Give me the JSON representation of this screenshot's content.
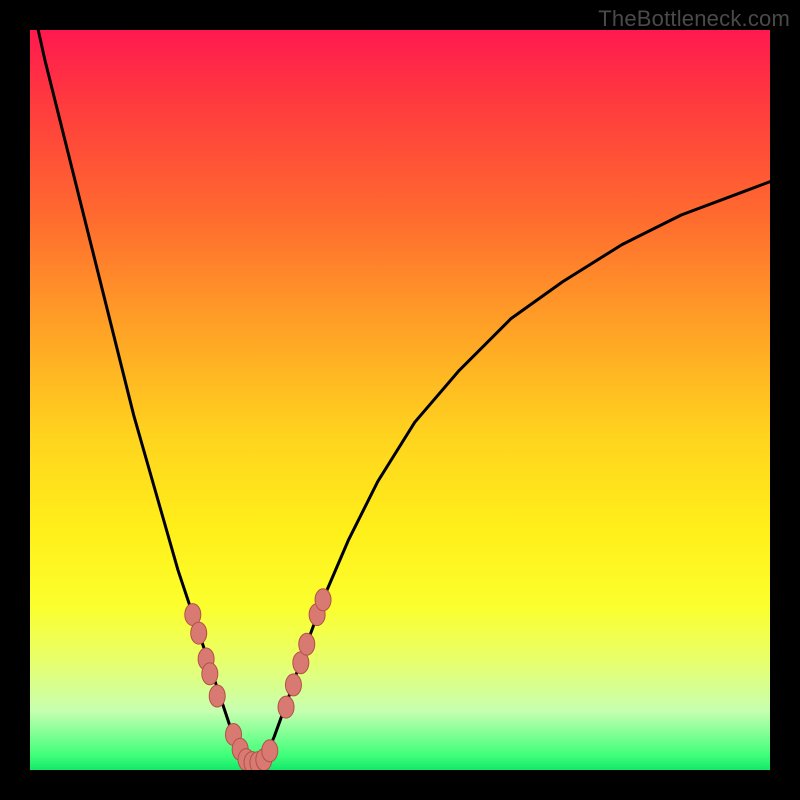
{
  "watermark": "TheBottleneck.com",
  "colors": {
    "frame": "#000000",
    "curve": "#000000",
    "marker_fill": "#d97a72",
    "marker_stroke": "#b25048"
  },
  "chart_data": {
    "type": "line",
    "title": "",
    "xlabel": "",
    "ylabel": "",
    "xlim": [
      0,
      100
    ],
    "ylim": [
      0,
      100
    ],
    "grid": false,
    "series": [
      {
        "name": "bottleneck-curve",
        "x": [
          0,
          2,
          4,
          6,
          8,
          10,
          12,
          14,
          16,
          18,
          20,
          22,
          24,
          26,
          27,
          28,
          29,
          30,
          31,
          32,
          33,
          35,
          37,
          40,
          43,
          47,
          52,
          58,
          65,
          72,
          80,
          88,
          96,
          100
        ],
        "y": [
          105,
          96,
          88,
          80,
          72,
          64,
          56,
          48,
          41,
          34,
          27,
          21,
          15,
          9,
          6,
          4,
          2.2,
          1.2,
          1.2,
          2.2,
          4.5,
          10,
          16,
          24,
          31,
          39,
          47,
          54,
          61,
          66,
          71,
          75,
          78,
          79.5
        ]
      }
    ],
    "markers": {
      "name": "highlighted-points",
      "points": [
        {
          "x": 22.0,
          "y": 21.0
        },
        {
          "x": 22.8,
          "y": 18.5
        },
        {
          "x": 23.8,
          "y": 15.0
        },
        {
          "x": 24.3,
          "y": 13.0
        },
        {
          "x": 25.3,
          "y": 10.0
        },
        {
          "x": 27.5,
          "y": 4.8
        },
        {
          "x": 28.4,
          "y": 2.8
        },
        {
          "x": 29.2,
          "y": 1.4
        },
        {
          "x": 30.0,
          "y": 1.0
        },
        {
          "x": 30.8,
          "y": 1.0
        },
        {
          "x": 31.6,
          "y": 1.4
        },
        {
          "x": 32.4,
          "y": 2.6
        },
        {
          "x": 34.6,
          "y": 8.5
        },
        {
          "x": 35.6,
          "y": 11.5
        },
        {
          "x": 36.6,
          "y": 14.5
        },
        {
          "x": 37.4,
          "y": 17.0
        },
        {
          "x": 38.8,
          "y": 21.0
        },
        {
          "x": 39.6,
          "y": 23.0
        }
      ]
    }
  }
}
